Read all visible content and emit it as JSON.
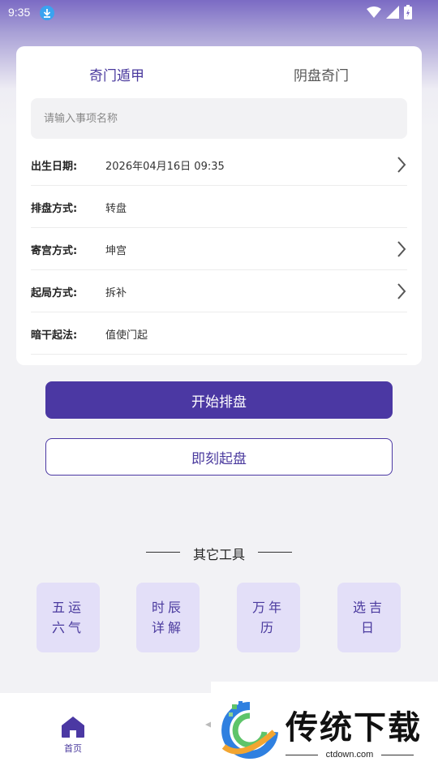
{
  "status_bar": {
    "time": "9:35"
  },
  "tabs": [
    {
      "label": "奇门遁甲",
      "active": true
    },
    {
      "label": "阴盘奇门",
      "active": false
    }
  ],
  "name_input": {
    "placeholder": "请输入事项名称",
    "value": ""
  },
  "rows": [
    {
      "label": "出生日期:",
      "value": "2026年04月16日 09:35",
      "has_chevron": true
    },
    {
      "label": "排盘方式:",
      "value": "转盘",
      "has_chevron": false
    },
    {
      "label": "寄宫方式:",
      "value": "坤宫",
      "has_chevron": true
    },
    {
      "label": "起局方式:",
      "value": "拆补",
      "has_chevron": true
    },
    {
      "label": "暗干起法:",
      "value": "值使门起",
      "has_chevron": false
    }
  ],
  "buttons": {
    "start": "开始排盘",
    "now": "即刻起盘"
  },
  "tools": {
    "title": "其它工具",
    "items": [
      {
        "line1": "五运",
        "line2": "六气"
      },
      {
        "line1": "时辰",
        "line2": "详解"
      },
      {
        "line1": "万年",
        "line2": "历"
      },
      {
        "line1": "选吉",
        "line2": "日"
      }
    ]
  },
  "bottom_nav": {
    "home_label": "首页"
  },
  "watermark": {
    "brand": "传统下载",
    "url": "ctdown.com"
  },
  "colors": {
    "accent": "#4b38a3",
    "tool_bg": "#e3dff8"
  }
}
